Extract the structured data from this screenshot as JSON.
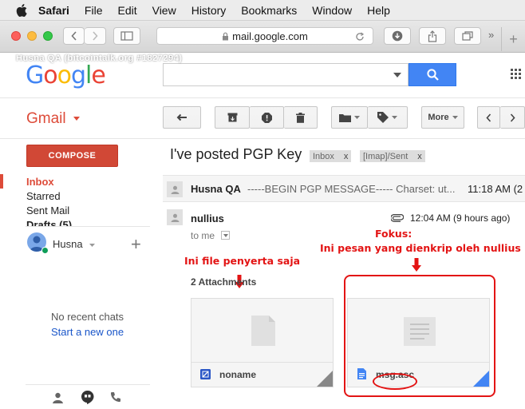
{
  "menubar": {
    "app": "Safari",
    "items": [
      "File",
      "Edit",
      "View",
      "History",
      "Bookmarks",
      "Window",
      "Help"
    ]
  },
  "browser": {
    "url": "mail.google.com",
    "watermark": "Husna QA (bitcointalk.org #1827294)"
  },
  "gmail": {
    "logo_letters": [
      {
        "ch": "G",
        "color": "#4285f4"
      },
      {
        "ch": "o",
        "color": "#ea4335"
      },
      {
        "ch": "o",
        "color": "#fbbc05"
      },
      {
        "ch": "g",
        "color": "#4285f4"
      },
      {
        "ch": "l",
        "color": "#34a853"
      },
      {
        "ch": "e",
        "color": "#ea4335"
      }
    ],
    "app_label": "Gmail",
    "compose": "COMPOSE",
    "more_button": "More",
    "nav": [
      "Inbox",
      "Starred",
      "Sent Mail",
      "Drafts (5)"
    ],
    "user_name": "Husna",
    "no_chats": "No recent chats",
    "start_new": "Start a new one"
  },
  "thread": {
    "subject": "I've posted PGP Key",
    "labels": [
      "Inbox",
      "[Imap]/Sent"
    ],
    "collapsed": {
      "sender": "Husna QA",
      "snippet": "-----BEGIN PGP MESSAGE----- Charset: ut...",
      "time": "11:18 AM (2"
    },
    "message": {
      "sender": "nullius",
      "to": "to me",
      "time": "12:04 AM (9 hours ago)",
      "attachments_title": "2 Attachments",
      "attachments": [
        {
          "name": "noname"
        },
        {
          "name": "msg.asc"
        }
      ]
    }
  },
  "annotations": {
    "focus_title": "Fokus:",
    "focus_desc": "Ini pesan yang dienkrip oleh nullius",
    "attach_note": "Ini file penyerta saja"
  },
  "colors": {
    "annotation": "#e31414",
    "search_blue": "#4285f4",
    "compose_red": "#d14836"
  }
}
